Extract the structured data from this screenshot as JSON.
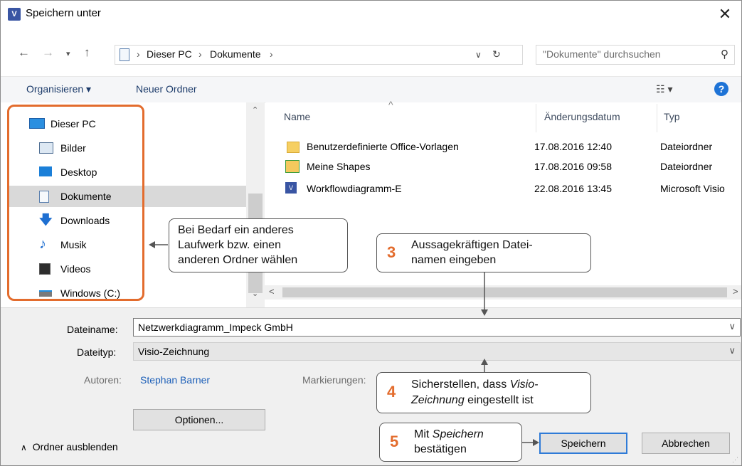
{
  "titlebar": {
    "app_icon": "visio-icon",
    "title": "Speichern unter",
    "close_icon": "close-icon"
  },
  "nav": {
    "back_icon": "arrow-left-icon",
    "forward_icon": "arrow-right-icon",
    "recent_icon": "chevron-down-icon",
    "up_icon": "arrow-up-icon",
    "breadcrumb": [
      "Dieser PC",
      "Dokumente"
    ],
    "refresh_icon": "refresh-icon"
  },
  "search": {
    "placeholder": "\"Dokumente\" durchsuchen",
    "icon": "search-icon"
  },
  "toolbar": {
    "organize": "Organisieren ▾",
    "new_folder": "Neuer Ordner",
    "view_icon": "view-options-icon",
    "help_label": "?"
  },
  "sidebar": {
    "items": [
      {
        "label": "Dieser PC",
        "icon": "computer-icon"
      },
      {
        "label": "Bilder",
        "icon": "pictures-icon"
      },
      {
        "label": "Desktop",
        "icon": "desktop-icon"
      },
      {
        "label": "Dokumente",
        "icon": "documents-icon",
        "selected": true
      },
      {
        "label": "Downloads",
        "icon": "download-icon"
      },
      {
        "label": "Musik",
        "icon": "music-icon"
      },
      {
        "label": "Videos",
        "icon": "videos-icon"
      },
      {
        "label": "Windows (C:)",
        "icon": "drive-icon"
      }
    ]
  },
  "filelist": {
    "columns": [
      "Name",
      "Änderungsdatum",
      "Typ"
    ],
    "rows": [
      {
        "name": "Benutzerdefinierte Office-Vorlagen",
        "date": "17.08.2016 12:40",
        "type": "Dateiordner",
        "icon": "folder-icon"
      },
      {
        "name": "Meine Shapes",
        "date": "17.08.2016 09:58",
        "type": "Dateiordner",
        "icon": "shapes-folder-icon"
      },
      {
        "name": "Workflowdiagramm-E",
        "date": "22.08.2016 13:45",
        "type": "Microsoft Visio",
        "icon": "visio-file-icon"
      }
    ]
  },
  "form": {
    "filename_label": "Dateiname:",
    "filename_value": "Netzwerkdiagramm_Impeck GmbH",
    "filetype_label": "Dateityp:",
    "filetype_value": "Visio-Zeichnung",
    "authors_label": "Autoren:",
    "authors_value": "Stephan Barner",
    "tags_label": "Markierungen:"
  },
  "buttons": {
    "options": "Optionen...",
    "save": "Speichern",
    "cancel": "Abbrechen",
    "hide_folders": "Ordner ausblenden"
  },
  "callouts": {
    "folder_hint": [
      "Bei Bedarf ein anderes",
      "Laufwerk bzw. einen",
      "anderen Ordner wählen"
    ],
    "step3": {
      "num": "3",
      "lines": [
        "Aussagekräftigen Datei-",
        "namen eingeben"
      ]
    },
    "step4": {
      "num": "4",
      "line1_pre": "Sicherstellen, dass ",
      "line1_em": "Visio-",
      "line2_em": "Zeichnung",
      "line2_post": " eingestellt ist"
    },
    "step5": {
      "num": "5",
      "line1_pre": "Mit ",
      "line1_em": "Speichern",
      "line2": "bestätigen"
    }
  },
  "colors": {
    "accent_orange": "#e36c2d",
    "link_blue": "#1c5fb8",
    "primary_border": "#2f7bd7"
  }
}
